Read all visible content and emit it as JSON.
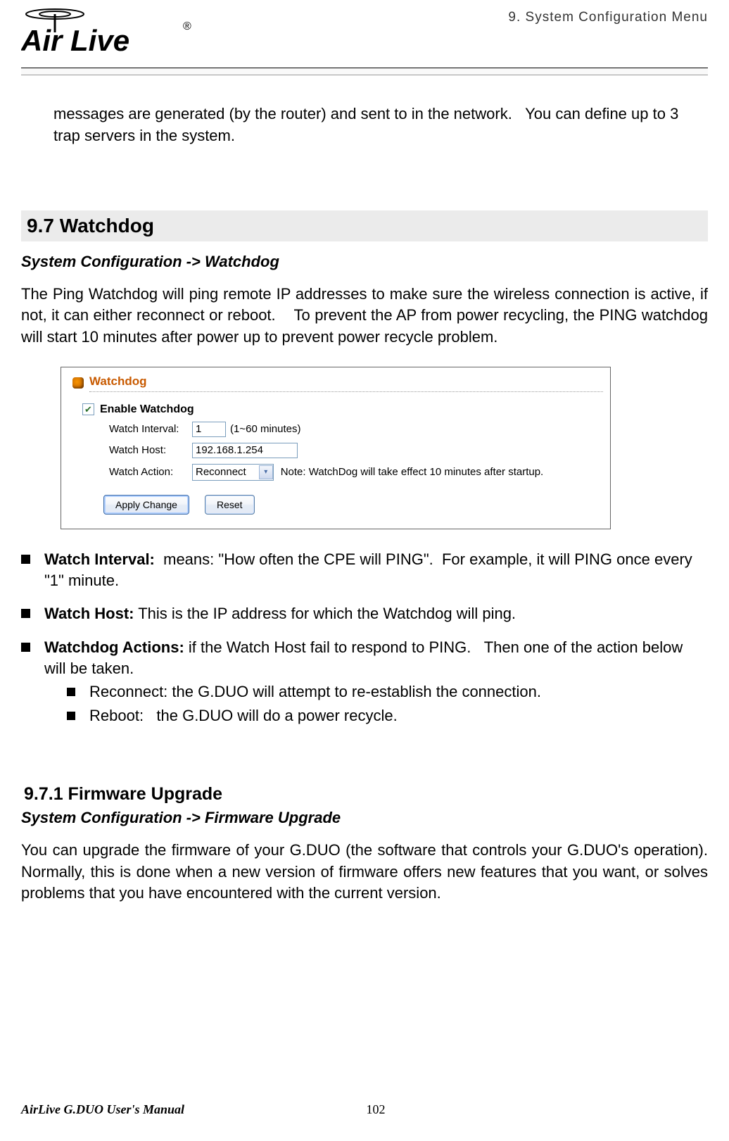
{
  "header": {
    "chapter": "9. System Configuration Menu",
    "logo_text": "AirLive",
    "logo_tm": "®"
  },
  "intro_para": "messages are generated (by the router) and sent to in the network.   You can define up to 3 trap servers in the system.",
  "section97": {
    "heading": "9.7 Watchdog",
    "breadcrumb": "System Configuration -> Watchdog",
    "desc": "The Ping Watchdog will ping remote IP addresses to make sure the wireless connection is active, if not, it can either reconnect or reboot.    To prevent the AP from power recycling, the PING watchdog will start 10 minutes after power up to prevent power recycle problem."
  },
  "ui": {
    "panel_title": "Watchdog",
    "enable_label": "Enable Watchdog",
    "enable_checked": true,
    "interval_label": "Watch Interval:",
    "interval_value": "1",
    "interval_suffix": "(1~60 minutes)",
    "host_label": "Watch Host:",
    "host_value": "192.168.1.254",
    "action_label": "Watch Action:",
    "action_value": "Reconnect",
    "action_note": "Note: WatchDog will take effect 10 minutes after startup.",
    "btn_apply": "Apply Change",
    "btn_reset": "Reset"
  },
  "bullets": {
    "interval_label": "Watch Interval:",
    "interval_text": "  means: \"How often the CPE will PING\".  For example, it will PING once every \"1\" minute.",
    "host_label": "Watch Host:",
    "host_text": " This is the IP address for which the Watchdog will ping.",
    "actions_label": "Watchdog Actions:",
    "actions_text": " if the Watch Host fail to respond to PING.   Then one of the action below will be taken.",
    "sub1": "Reconnect: the G.DUO will attempt to re-establish the connection.",
    "sub2": "Reboot:   the G.DUO will do a power recycle."
  },
  "section971": {
    "heading": "9.7.1 Firmware Upgrade",
    "breadcrumb": "System Configuration -> Firmware Upgrade",
    "desc": "You can upgrade the firmware of your G.DUO (the software that controls your G.DUO's operation). Normally, this is done when a new version of firmware offers new features that you want, or solves problems that you have encountered with the current version."
  },
  "footer": {
    "left": "AirLive G.DUO User's Manual",
    "page": "102"
  }
}
